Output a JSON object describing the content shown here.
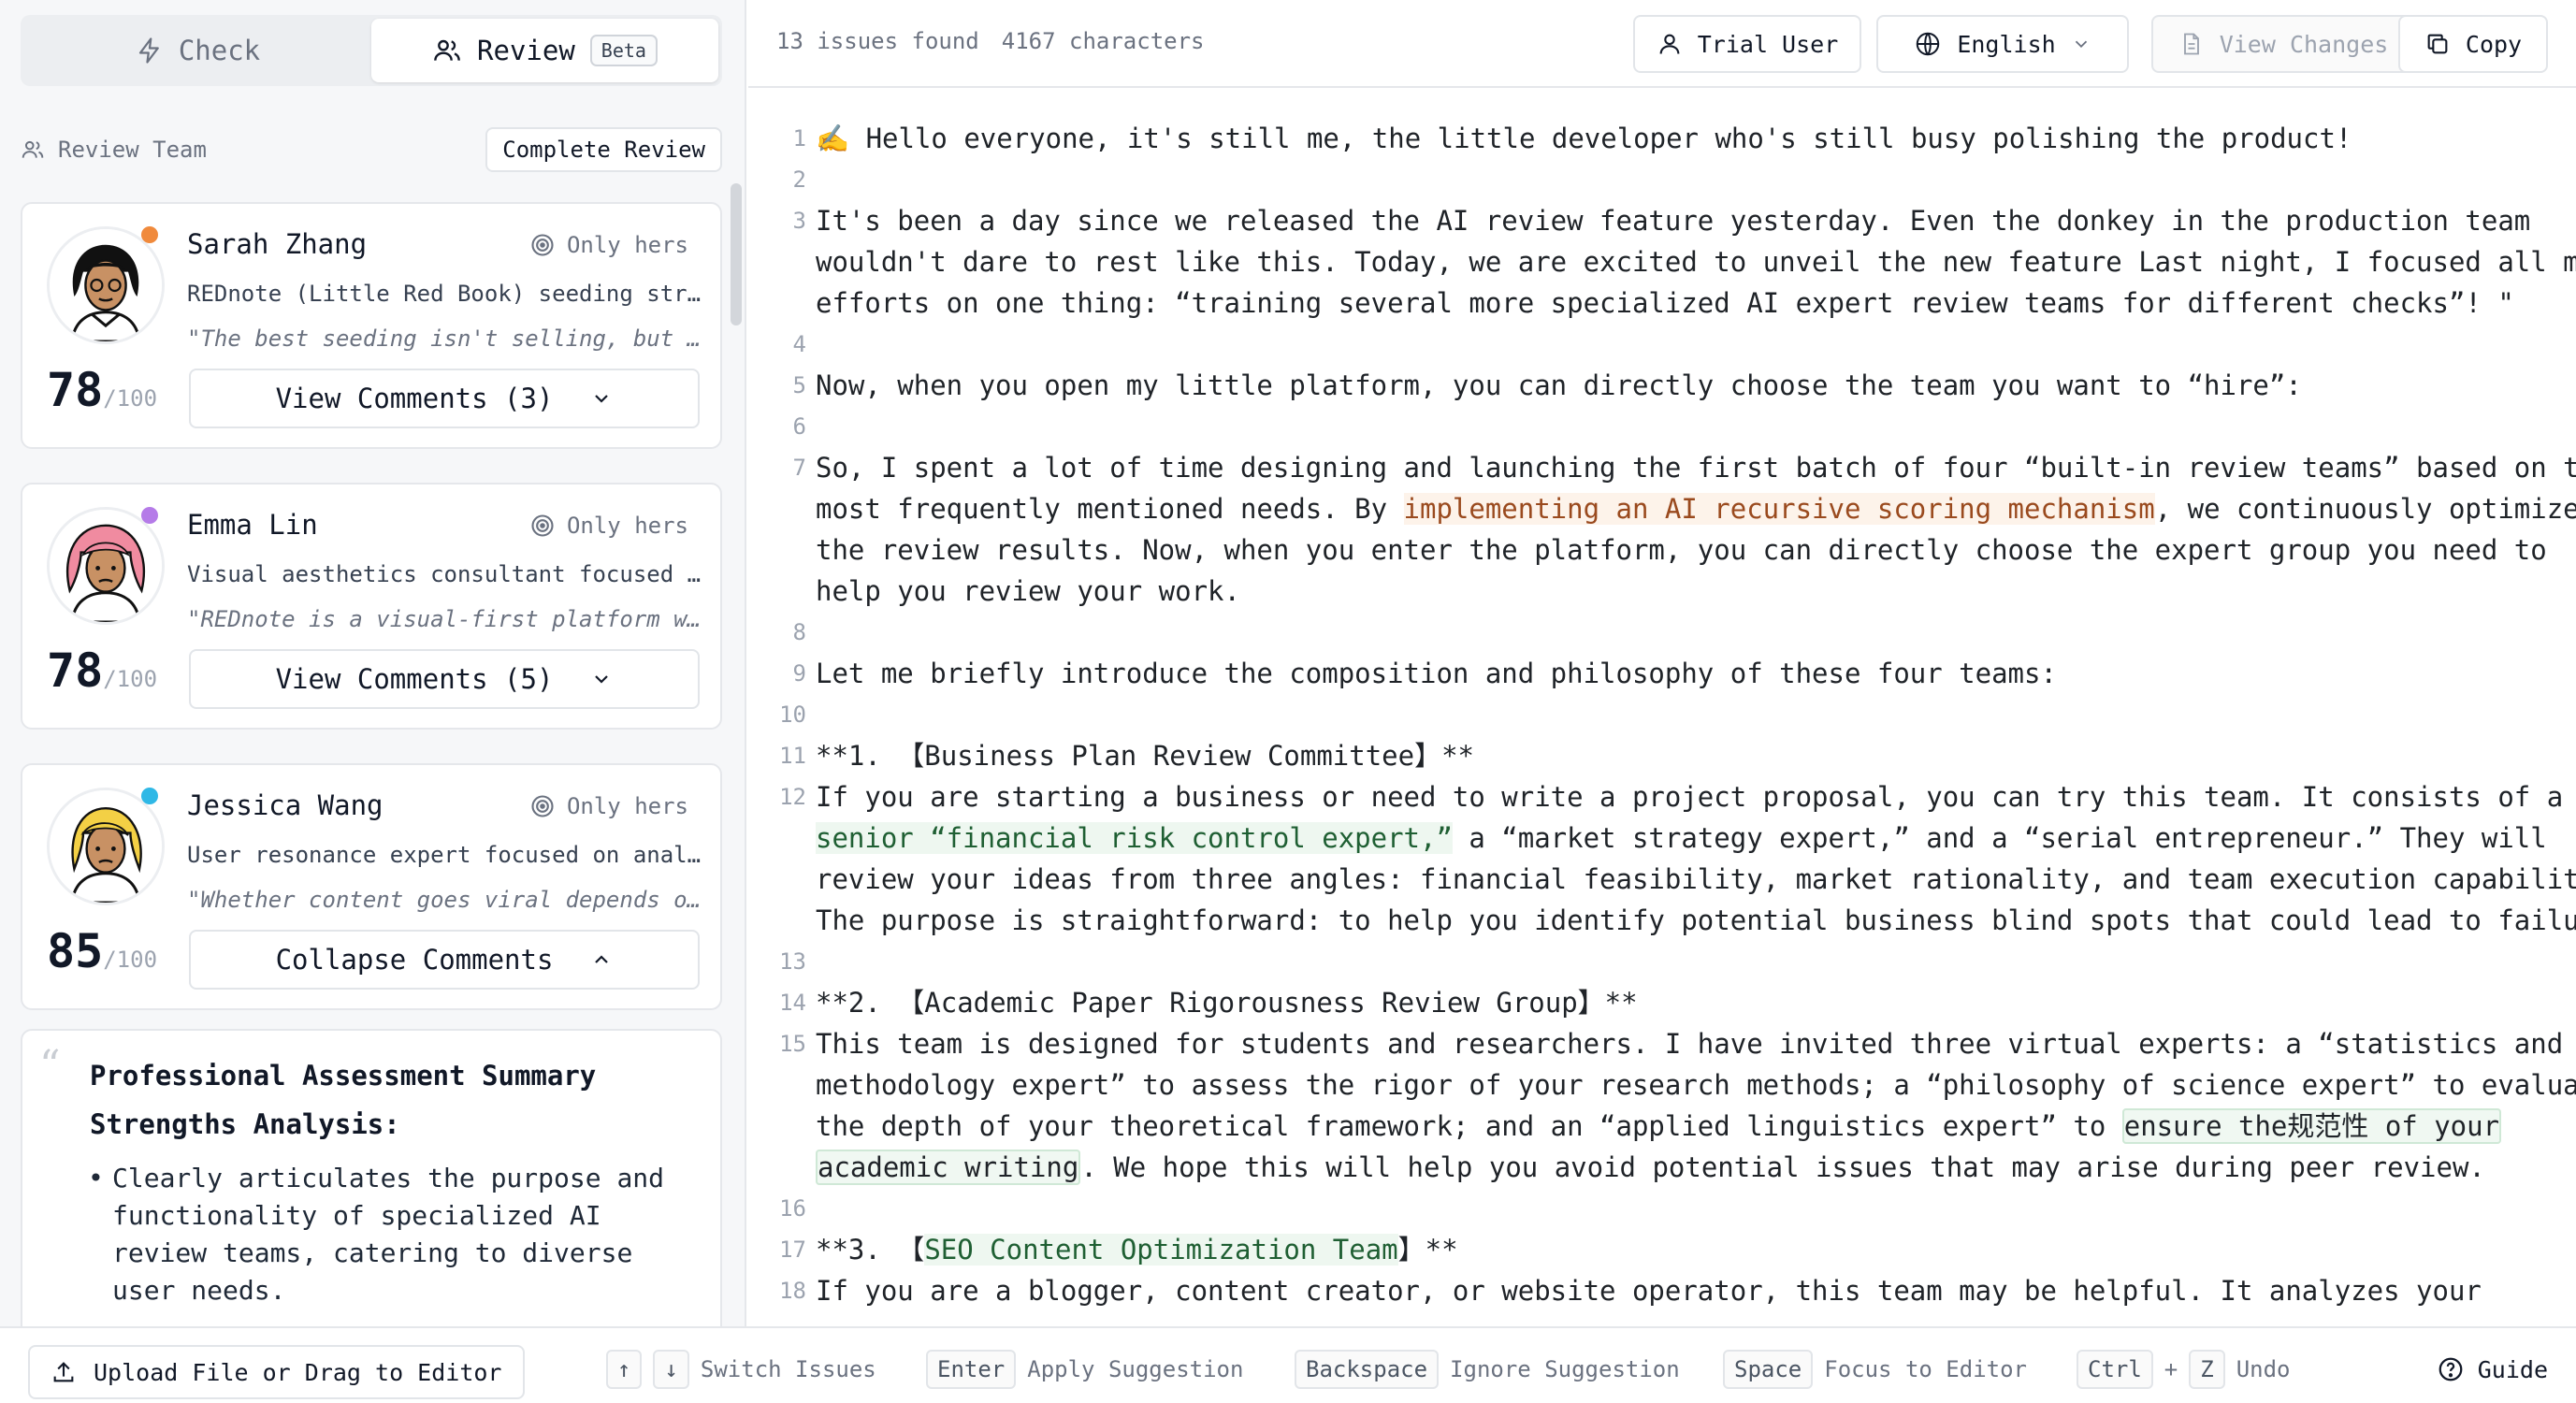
{
  "mode_tabs": {
    "check": "Check",
    "review": "Review",
    "beta": "Beta"
  },
  "team": {
    "label": "Review Team",
    "complete_button": "Complete Review"
  },
  "reviewers": [
    {
      "name": "Sarah Zhang",
      "only": "Only hers",
      "role": "REDnote (Little Red Book) seeding strategist",
      "quote": "\"The best seeding isn't selling, but sharing...",
      "score": "78",
      "score_max": "/100",
      "comments_label": "View Comments (3)",
      "dot_color": "#f08a3c"
    },
    {
      "name": "Emma Lin",
      "only": "Only hers",
      "role": "Visual aesthetics consultant focused on layout",
      "quote": "\"REDnote is a visual-first platform where...",
      "score": "78",
      "score_max": "/100",
      "comments_label": "View Comments (5)",
      "dot_color": "#b57be8"
    },
    {
      "name": "Jessica Wang",
      "only": "Only hers",
      "role": "User resonance expert focused on analysis",
      "quote": "\"Whether content goes viral depends on...",
      "score": "85",
      "score_max": "/100",
      "comments_label": "Collapse Comments",
      "dot_color": "#2fb8e6"
    }
  ],
  "summary": {
    "title": "Professional Assessment Summary",
    "subtitle": "Strengths Analysis:",
    "bullets": [
      "Clearly articulates the purpose and functionality of specialized AI review teams, catering to diverse user needs."
    ]
  },
  "topbar": {
    "issues": "13 issues found",
    "characters": "4167 characters",
    "user": "Trial User",
    "language": "English",
    "view_changes": "View Changes",
    "copy": "Copy"
  },
  "editor_lines": [
    {
      "n": "1",
      "segs": [
        {
          "t": "✍️ Hello everyone, it's still me, the little developer who's still busy polishing the product!"
        }
      ]
    },
    {
      "n": "2",
      "segs": [
        {
          "t": ""
        }
      ]
    },
    {
      "n": "3",
      "segs": [
        {
          "t": "It's been a day since we released the AI review feature yesterday. Even the donkey in the production team"
        }
      ]
    },
    {
      "n": "",
      "segs": [
        {
          "t": "wouldn't dare to rest like this. Today, we are excited to unveil the new feature Last night, I focused all my"
        }
      ]
    },
    {
      "n": "",
      "segs": [
        {
          "t": "efforts on one thing: “training several more specialized AI expert review teams for different checks”! \""
        }
      ]
    },
    {
      "n": "4",
      "segs": [
        {
          "t": ""
        }
      ]
    },
    {
      "n": "5",
      "segs": [
        {
          "t": "Now, when you open my little platform, you can directly choose the team you want to “hire”:"
        }
      ]
    },
    {
      "n": "6",
      "segs": [
        {
          "t": ""
        }
      ]
    },
    {
      "n": "7",
      "segs": [
        {
          "t": "So, I spent a lot of time designing and launching the first batch of four “built-in review teams” based on the"
        }
      ]
    },
    {
      "n": "",
      "segs": [
        {
          "t": "most frequently mentioned needs. By "
        },
        {
          "t": "implementing an AI recursive scoring mechanism",
          "c": "hl-orange"
        },
        {
          "t": ", we continuously optimize"
        }
      ]
    },
    {
      "n": "",
      "segs": [
        {
          "t": "the review results. Now, when you enter the platform, you can directly choose the expert group you need to"
        }
      ]
    },
    {
      "n": "",
      "segs": [
        {
          "t": "help you review your work."
        }
      ]
    },
    {
      "n": "8",
      "segs": [
        {
          "t": ""
        }
      ]
    },
    {
      "n": "9",
      "segs": [
        {
          "t": "Let me briefly introduce the composition and philosophy of these four teams:"
        }
      ]
    },
    {
      "n": "10",
      "segs": [
        {
          "t": ""
        }
      ]
    },
    {
      "n": "11",
      "segs": [
        {
          "t": "**1. 【Business Plan Review Committee】**"
        }
      ]
    },
    {
      "n": "12",
      "segs": [
        {
          "t": "If you are starting a business or need to write a project proposal, you can try this team. It consists of a"
        }
      ]
    },
    {
      "n": "",
      "segs": [
        {
          "t": "senior “financial risk control expert,”",
          "c": "hl-green"
        },
        {
          "t": " a “market strategy expert,” and a “serial entrepreneur.” They will"
        }
      ]
    },
    {
      "n": "",
      "segs": [
        {
          "t": "review your ideas from three angles: financial feasibility, market rationality, and team execution capability."
        }
      ]
    },
    {
      "n": "",
      "segs": [
        {
          "t": "The purpose is straightforward: to help you identify potential business blind spots that could lead to failure."
        }
      ]
    },
    {
      "n": "13",
      "segs": [
        {
          "t": ""
        }
      ]
    },
    {
      "n": "14",
      "segs": [
        {
          "t": "**2. 【Academic Paper Rigorousness Review Group】**"
        }
      ]
    },
    {
      "n": "15",
      "segs": [
        {
          "t": "This team is designed for students and researchers. I have invited three virtual experts: a “statistics and"
        }
      ]
    },
    {
      "n": "",
      "segs": [
        {
          "t": "methodology expert” to assess the rigor of your research methods; a “philosophy of science expert” to evaluate"
        }
      ]
    },
    {
      "n": "",
      "segs": [
        {
          "t": "the depth of your theoretical framework; and an “applied linguistics expert” to "
        },
        {
          "t": "ensure the规范性 of your ",
          "c": "hl-box"
        }
      ]
    },
    {
      "n": "",
      "segs": [
        {
          "t": "academic writing",
          "c": "hl-box"
        },
        {
          "t": "."
        },
        {
          "t": " We hope this will help you avoid potential issues that may arise during peer review."
        }
      ]
    },
    {
      "n": "16",
      "segs": [
        {
          "t": ""
        }
      ]
    },
    {
      "n": "17",
      "segs": [
        {
          "t": "**3. 【"
        },
        {
          "t": "SEO Content Optimization Team",
          "c": "hl-green"
        },
        {
          "t": "】**"
        }
      ]
    },
    {
      "n": "18",
      "segs": [
        {
          "t": "If you are a blogger, content creator, or website operator, this team may be helpful. It analyzes your"
        }
      ]
    }
  ],
  "bottombar": {
    "upload": "Upload File or Drag to Editor",
    "up_key": "↑",
    "down_key": "↓",
    "switch": "Switch Issues",
    "enter_key": "Enter",
    "apply": "Apply Suggestion",
    "backspace_key": "Backspace",
    "ignore": "Ignore Suggestion",
    "space_key": "Space",
    "focus": "Focus to Editor",
    "ctrl_key": "Ctrl",
    "plus": "+",
    "z_key": "Z",
    "undo": "Undo",
    "guide": "Guide"
  }
}
